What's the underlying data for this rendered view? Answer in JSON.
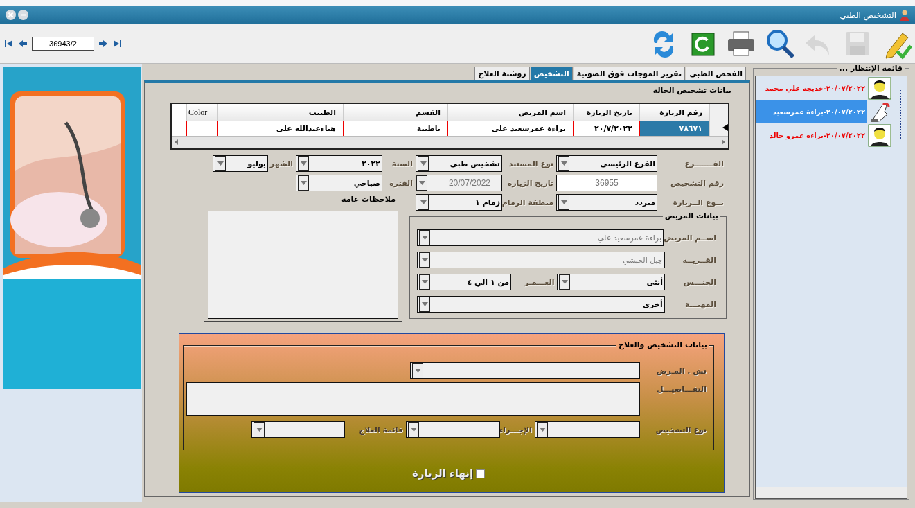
{
  "window": {
    "title": "التشخيص الطبي"
  },
  "navigator": {
    "record": "36943/2"
  },
  "toolbar": [
    {
      "kind": "edit",
      "disabled": false
    },
    {
      "kind": "save",
      "disabled": true
    },
    {
      "kind": "undo",
      "disabled": true
    },
    {
      "kind": "search",
      "disabled": false
    },
    {
      "kind": "print",
      "disabled": false
    },
    {
      "kind": "reload",
      "disabled": false
    },
    {
      "kind": "refresh",
      "disabled": false
    }
  ],
  "tabs": [
    {
      "label": "الفحص الطبي",
      "selected": false
    },
    {
      "label": "تقرير الموجات فوق الصوتية",
      "selected": false
    },
    {
      "label": "التشخيص",
      "selected": true
    },
    {
      "label": "روشتة العلاج",
      "selected": false
    }
  ],
  "case_grid": {
    "title": "بيانات تشخيص الحالة",
    "columns": [
      "رقم الزيارة",
      "تاريخ الزيارة",
      "اسم المريض",
      "القسم",
      "الطبيب",
      "Color"
    ],
    "rows": [
      {
        "selected": true,
        "cells": [
          "٧٨٦٧١",
          "٢٠/٧/٢٠٢٢",
          "براءة عمرسعيد على",
          "باطنية",
          "هناءعبدالله على",
          ""
        ]
      }
    ]
  },
  "visit_rows": [
    [
      {
        "label": "الفـــــــرع",
        "kind": "combo",
        "value": "الفرع الرئيسي",
        "disabled": false
      },
      {
        "label": "نوع المستند",
        "kind": "combo",
        "value": "تشخيص طبي",
        "disabled": false
      },
      {
        "label": "السنة",
        "kind": "combo",
        "value": "٢٠٢٢",
        "disabled": false
      },
      {
        "label": "الشهر",
        "kind": "combo",
        "value": "يوليو",
        "disabled": false
      }
    ],
    [
      {
        "label": "رقم التشخيص",
        "kind": "text",
        "value": "36955",
        "disabled": true
      },
      {
        "label": "تاريخ الزيارة",
        "kind": "date",
        "value": "20/07/2022",
        "disabled": true
      },
      {
        "label": "الفترة",
        "kind": "combo",
        "value": "صباحي",
        "disabled": false
      }
    ],
    [
      {
        "label": "نــوع الــزيارة",
        "kind": "combo",
        "value": "متردد",
        "disabled": false
      },
      {
        "label": "منطقة الزمام",
        "kind": "combo",
        "value": "زمام ١",
        "disabled": false
      }
    ]
  ],
  "notes": {
    "title": "ملاحظات عامة"
  },
  "patient": {
    "title": "بيانات المريض",
    "rows": [
      [
        {
          "label": "اســم المريض",
          "kind": "combo",
          "value": "براءة عمرسعيد علي",
          "disabled": true
        }
      ],
      [
        {
          "label": "القــريــة",
          "kind": "combo",
          "value": "جبل الحبشي",
          "disabled": true
        }
      ],
      [
        {
          "label": "الجنـــس",
          "kind": "combo",
          "value": "أنثى",
          "disabled": false
        },
        {
          "label": "العـــمـر",
          "kind": "combo",
          "value": "من ١ الي ٤",
          "disabled": false
        }
      ],
      [
        {
          "label": "المهنـــة",
          "kind": "combo",
          "value": "أخرى",
          "disabled": false
        }
      ]
    ]
  },
  "diagnosis": {
    "title": "بيانات التشخيص والعلاج",
    "disease": {
      "label": "تش . المـرض"
    },
    "details": {
      "label": "التفـــاصيـــل"
    },
    "fields": [
      {
        "label": "نوع التشخيص"
      },
      {
        "label": "الإجـــراء"
      },
      {
        "label": "قائمة العلاج"
      }
    ]
  },
  "end_visit": {
    "label": "إنهاء الزيارة",
    "checked": false
  },
  "waiting_list": {
    "title": "قائمة الإنتظار ...",
    "items": [
      {
        "text": "٢٠/٠٧/٢٠٢٢-خديجه علي محمد",
        "kind": "person",
        "selected": false
      },
      {
        "text": "٢٠/٠٧/٢٠٢٢-براءة عمرسعيد",
        "kind": "hand",
        "selected": true
      },
      {
        "text": "٢٠/٠٧/٢٠٢٢-براءة عمرو خالد",
        "kind": "person",
        "selected": false
      }
    ]
  }
}
